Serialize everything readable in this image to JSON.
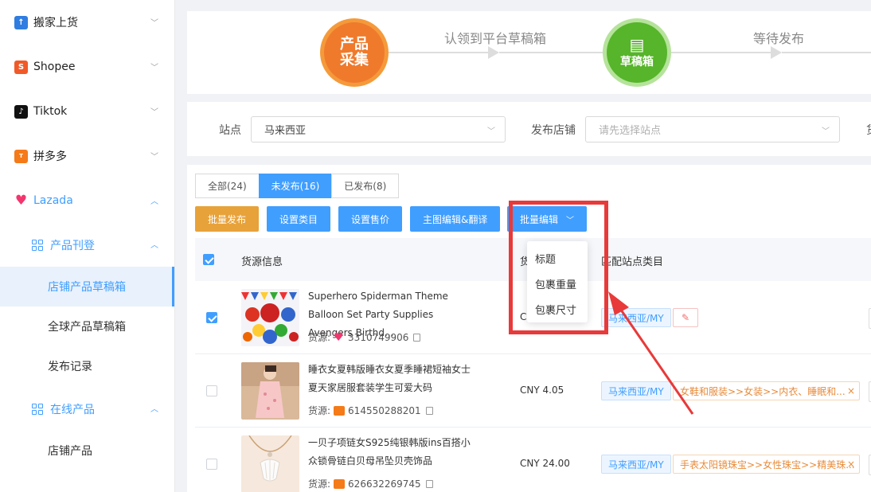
{
  "sidebar": {
    "platforms": [
      {
        "label": "搬家上货",
        "icon": "upload-icon",
        "color": "#2f7de1"
      },
      {
        "label": "Shopee",
        "icon": "shopee-icon",
        "color": "#f05a28"
      },
      {
        "label": "Tiktok",
        "icon": "tiktok-icon",
        "color": "#111111"
      },
      {
        "label": "拼多多",
        "icon": "temu-icon",
        "color": "#f57a18"
      },
      {
        "label": "Lazada",
        "icon": "lazada-heart-icon",
        "color": "#f2366e"
      }
    ],
    "product_listing": "产品刊登",
    "store_drafts": "店铺产品草稿箱",
    "global_drafts": "全球产品草稿箱",
    "publish_records": "发布记录",
    "online_products": "在线产品",
    "store_products": "店铺产品"
  },
  "steps": {
    "step1_line1": "产品",
    "step1_line2": "采集",
    "arrow1_text": "认领到平台草稿箱",
    "step2_label": "草稿箱",
    "arrow2_text": "等待发布"
  },
  "filters": {
    "site_label": "站点",
    "site_value": "马来西亚",
    "store_label": "发布店铺",
    "store_placeholder": "请先选择站点",
    "cut_label": "货"
  },
  "tabs": [
    "全部(24)",
    "未发布(16)",
    "已发布(8)"
  ],
  "actions": {
    "batch_publish": "批量发布",
    "set_category": "设置类目",
    "set_price": "设置售价",
    "main_image_edit": "主图编辑&翻译",
    "batch_edit": "批量编辑"
  },
  "table": {
    "col_source": "货源信息",
    "col_price_cut": "货",
    "col_category": "匹配站点类目",
    "source_prefix": "货源:",
    "rows": [
      {
        "title": "Superhero Spiderman Theme Balloon Set Party Supplies Avengers Birthd...",
        "source_id": "3310749906",
        "price": "C",
        "site_tag": "马来西亚/MY",
        "checked": true
      },
      {
        "title": "睡衣女夏韩版睡衣女夏季睡裙短袖女士夏天家居服套装学生可爱大码",
        "source_id": "614550288201",
        "price": "CNY 4.05",
        "site_tag": "马来西亚/MY",
        "category": "女鞋和服装>>女装>>内衣、睡眠和...",
        "checked": false
      },
      {
        "title": "一贝子项链女S925纯银韩版ins百搭小众锁骨链白贝母吊坠贝壳饰品",
        "source_id": "626632269745",
        "price": "CNY 24.00",
        "site_tag": "马来西亚/MY",
        "category": "手表太阳镜珠宝>>女性珠宝>>精美珠...",
        "checked": false
      }
    ]
  },
  "dropdown": {
    "options": [
      "标题",
      "包裹重量",
      "包裹尺寸"
    ]
  },
  "colors": {
    "primary": "#409eff",
    "orange_btn": "#e8a23a",
    "highlight": "#e83a3a"
  }
}
